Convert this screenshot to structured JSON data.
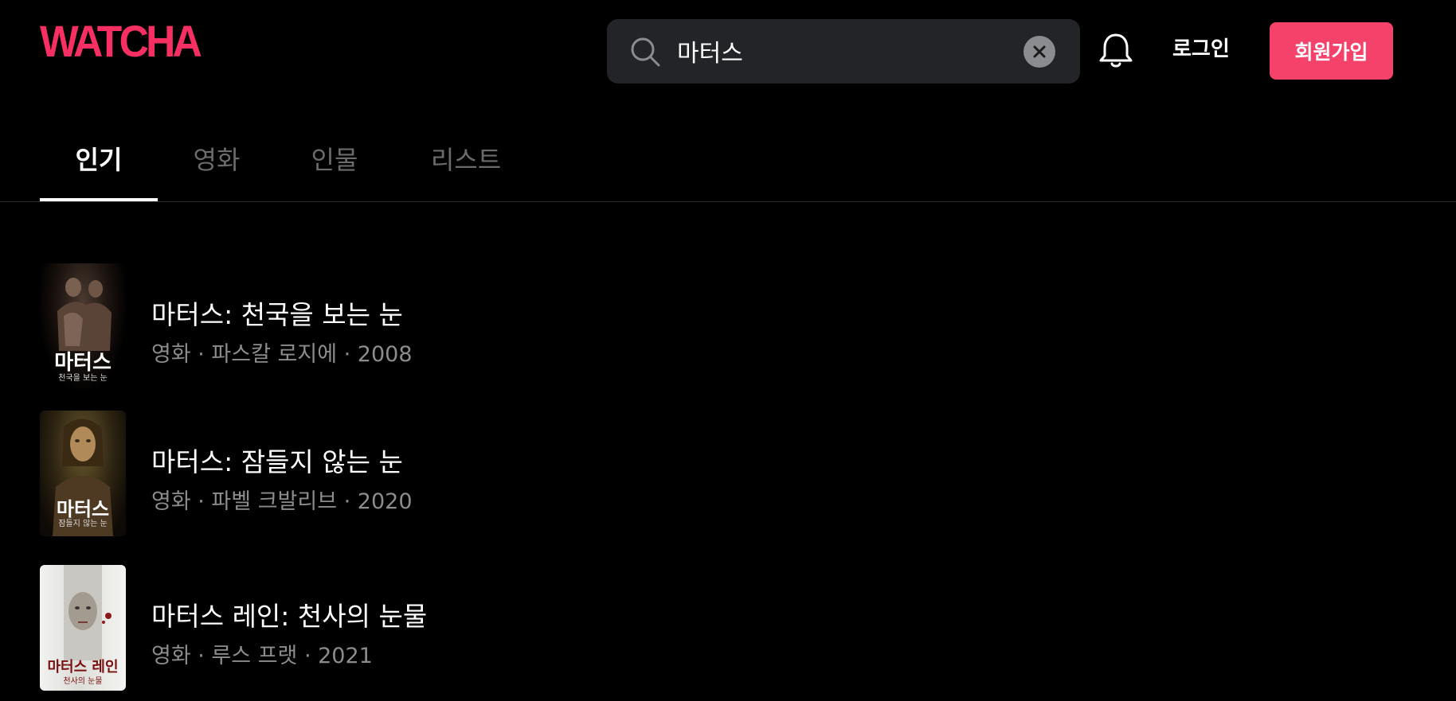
{
  "header": {
    "logo": "WATCHA",
    "search": {
      "value": "마터스",
      "placeholder": ""
    },
    "login_label": "로그인",
    "signup_label": "회원가입"
  },
  "tabs": [
    {
      "label": "인기",
      "active": true
    },
    {
      "label": "영화",
      "active": false
    },
    {
      "label": "인물",
      "active": false
    },
    {
      "label": "리스트",
      "active": false
    }
  ],
  "results": [
    {
      "title": "마터스: 천국을 보는 눈",
      "meta": "영화 · 파스칼 로지에 · 2008",
      "poster_title": "마터스",
      "poster_subtitle": "천국을 보는 눈"
    },
    {
      "title": "마터스: 잠들지 않는 눈",
      "meta": "영화 · 파벨 크발리브 · 2020",
      "poster_title": "마터스",
      "poster_subtitle": "잠들지 않는 눈"
    },
    {
      "title": "마터스 레인: 천사의 눈물",
      "meta": "영화 · 루스 프랫 · 2021",
      "poster_title": "마터스 레인",
      "poster_subtitle": "천사의 눈물"
    }
  ],
  "colors": {
    "brand": "#f82f62",
    "signup_bg": "#f4426b",
    "background": "#000000",
    "search_bg": "#232427",
    "meta_text": "#8c8c8c",
    "inactive_tab": "#6b6b6b"
  },
  "icons": {
    "search": "search-icon",
    "clear": "close-icon",
    "notifications": "bell-icon"
  }
}
